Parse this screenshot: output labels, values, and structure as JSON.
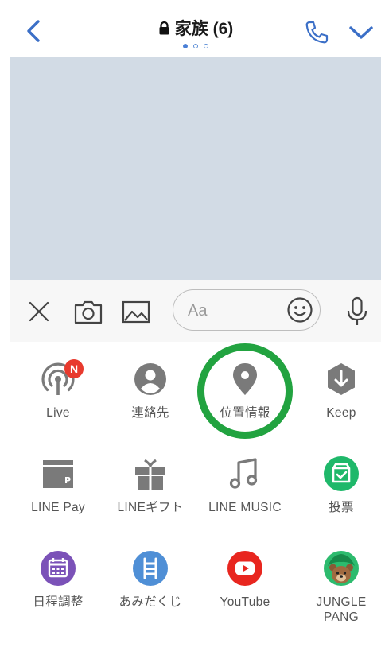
{
  "header": {
    "title": "家族 (6)",
    "back_icon": "chevron-left-icon",
    "lock_icon": "lock-icon",
    "call_icon": "phone-icon",
    "expand_icon": "chevron-down-icon",
    "page_dots": 3,
    "active_page": 1,
    "accent_color": "#3b6fc7"
  },
  "chat": {
    "background_color": "#d2dbe5"
  },
  "input_bar": {
    "close_icon": "close-icon",
    "camera_icon": "camera-icon",
    "image_icon": "image-icon",
    "message_placeholder": "Aa",
    "emoji_icon": "emoji-icon",
    "mic_icon": "microphone-icon"
  },
  "menu": {
    "items": [
      {
        "label": "Live",
        "icon": "live-broadcast-icon",
        "badge": "N"
      },
      {
        "label": "連絡先",
        "icon": "contact-icon"
      },
      {
        "label": "位置情報",
        "icon": "location-pin-icon",
        "highlighted": true
      },
      {
        "label": "Keep",
        "icon": "keep-icon"
      },
      {
        "label": "LINE Pay",
        "icon": "wallet-icon"
      },
      {
        "label": "LINEギフト",
        "icon": "gift-icon"
      },
      {
        "label": "LINE MUSIC",
        "icon": "music-note-icon"
      },
      {
        "label": "投票",
        "icon": "vote-icon",
        "color": "#1fb86a"
      },
      {
        "label": "日程調整",
        "icon": "calendar-icon",
        "color": "#7b52b8"
      },
      {
        "label": "あみだくじ",
        "icon": "ladder-icon",
        "color": "#4f8fd6"
      },
      {
        "label": "YouTube",
        "icon": "youtube-icon",
        "color": "#e8261f"
      },
      {
        "label": "JUNGLE\nPANG",
        "icon": "jungle-pang-icon",
        "color": "#2dbb6e"
      }
    ]
  },
  "highlight_color": "#22a340",
  "badge_color": "#e83a2e"
}
